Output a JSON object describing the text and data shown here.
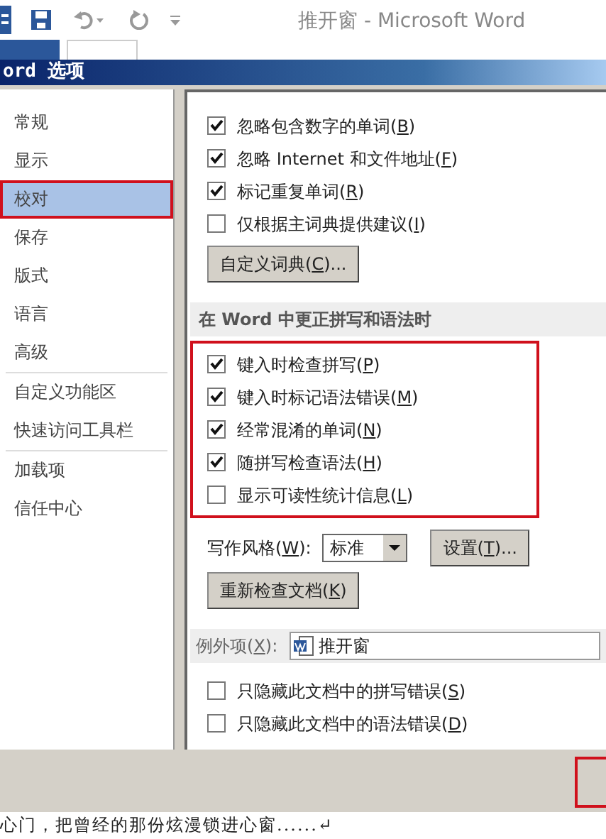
{
  "window": {
    "title": "推开窗 - Microsoft Word"
  },
  "ribbon_tabs": [
    {
      "kind": "file",
      "selected": false
    },
    {
      "kind": "tab",
      "selected": true
    }
  ],
  "dialog": {
    "title": "ord 选项",
    "nav": [
      {
        "label": "常规",
        "selected": false,
        "divider_after": false
      },
      {
        "label": "显示",
        "selected": false,
        "divider_after": false
      },
      {
        "label": "校对",
        "selected": true,
        "divider_after": false
      },
      {
        "label": "保存",
        "selected": false,
        "divider_after": false
      },
      {
        "label": "版式",
        "selected": false,
        "divider_after": false
      },
      {
        "label": "语言",
        "selected": false,
        "divider_after": false
      },
      {
        "label": "高级",
        "selected": false,
        "divider_after": true
      },
      {
        "label": "自定义功能区",
        "selected": false,
        "divider_after": false
      },
      {
        "label": "快速访问工具栏",
        "selected": false,
        "divider_after": true
      },
      {
        "label": "加载项",
        "selected": false,
        "divider_after": false
      },
      {
        "label": "信任中心",
        "selected": false,
        "divider_after": false
      }
    ],
    "autocorrect_options": [
      {
        "label": "忽略包含数字的单词(B)",
        "checked": true
      },
      {
        "label": "忽略 Internet 和文件地址(F)",
        "checked": true
      },
      {
        "label": "标记重复单词(R)",
        "checked": true
      },
      {
        "label": "仅根据主词典提供建议(I)",
        "checked": false
      }
    ],
    "custom_dictionary_button": "自定义词典(C)...",
    "section_header": "在 Word 中更正拼写和语法时",
    "grammar_options": [
      {
        "label": "键入时检查拼写(P)",
        "checked": true
      },
      {
        "label": "键入时标记语法错误(M)",
        "checked": true
      },
      {
        "label": "经常混淆的单词(N)",
        "checked": true
      },
      {
        "label": "随拼写检查语法(H)",
        "checked": true
      },
      {
        "label": "显示可读性统计信息(L)",
        "checked": false
      }
    ],
    "writing_style": {
      "label": "写作风格(W):",
      "value": "标准"
    },
    "settings_button": "设置(T)...",
    "recheck_button": "重新检查文档(K)",
    "exceptions": {
      "label": "例外项(X):",
      "value": "推开窗"
    },
    "exception_options": [
      {
        "label": "只隐藏此文档中的拼写错误(S)",
        "checked": false
      },
      {
        "label": "只隐藏此文档中的语法错误(D)",
        "checked": false
      }
    ]
  },
  "document_text": "心门，把曾经的那份炫漫锁进心窗......↵"
}
